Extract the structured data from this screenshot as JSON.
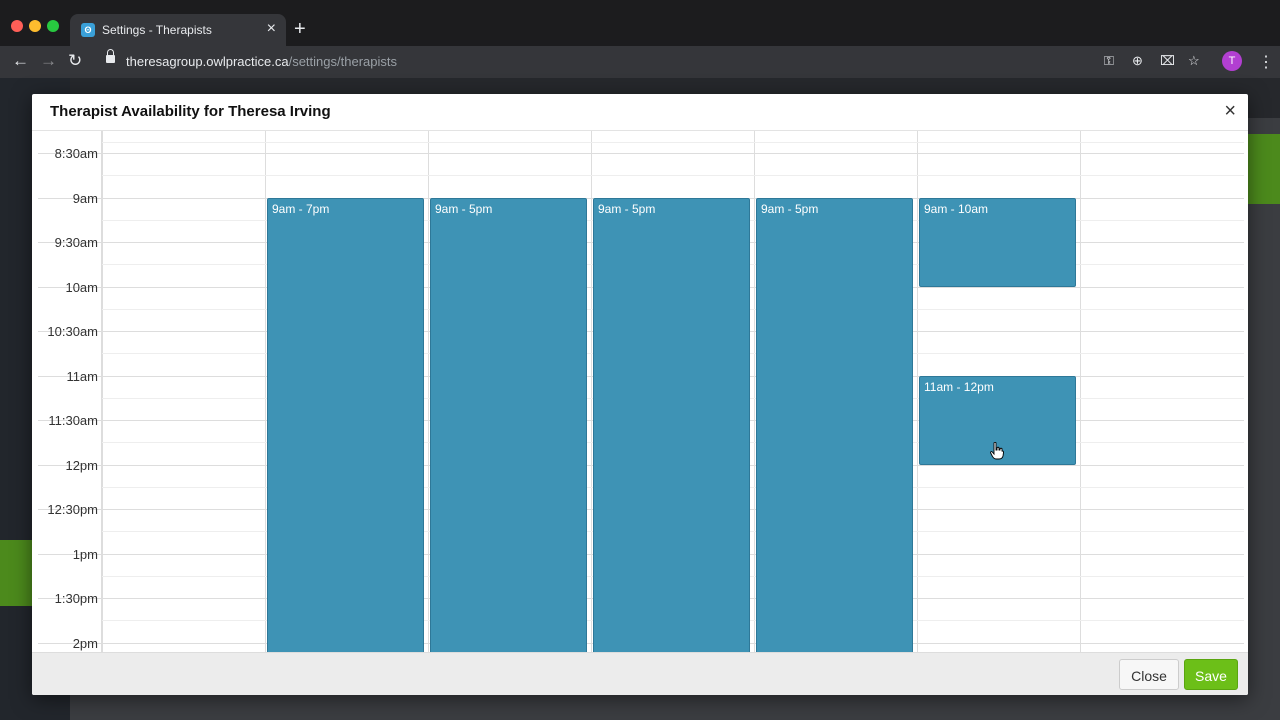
{
  "browser": {
    "tab_title": "Settings - Therapists",
    "tab_icon": "owl-favicon-icon",
    "url_host": "theresagroup.owlpractice.ca",
    "url_path": "/settings/therapists",
    "avatar_letter": "T",
    "avatar_color": "#b23fd1"
  },
  "modal": {
    "title": "Therapist Availability for Theresa Irving",
    "close_symbol": "×",
    "close_label": "Close",
    "save_label": "Save",
    "save_color": "#6cbf18"
  },
  "calendar": {
    "time_labels": [
      "8:30am",
      "9am",
      "9:30am",
      "10am",
      "10:30am",
      "11am",
      "11:30am",
      "12pm",
      "12:30pm",
      "1pm",
      "1:30pm",
      "2pm"
    ],
    "block_color": "#3e93b5",
    "blocks": [
      {
        "day": 1,
        "label": "9am - 7pm"
      },
      {
        "day": 2,
        "label": "9am - 5pm"
      },
      {
        "day": 3,
        "label": "9am - 5pm"
      },
      {
        "day": 4,
        "label": "9am - 5pm"
      },
      {
        "day": 5,
        "label": "9am - 10am"
      },
      {
        "day": 5,
        "label": "11am - 12pm"
      }
    ]
  }
}
